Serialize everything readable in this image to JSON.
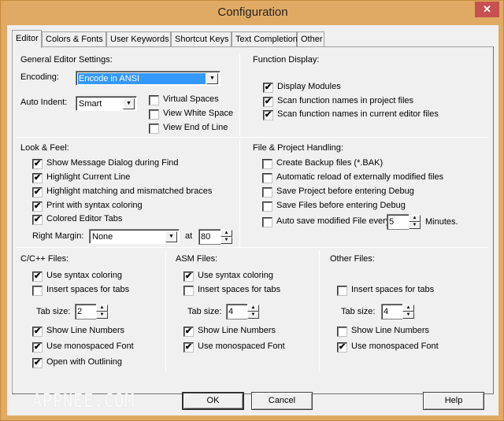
{
  "window": {
    "title": "Configuration",
    "close_icon": "close-icon"
  },
  "tabs": [
    {
      "label": "Editor",
      "active": true
    },
    {
      "label": "Colors & Fonts",
      "active": false
    },
    {
      "label": "User Keywords",
      "active": false
    },
    {
      "label": "Shortcut Keys",
      "active": false
    },
    {
      "label": "Text Completion",
      "active": false
    },
    {
      "label": "Other",
      "active": false
    }
  ],
  "general": {
    "heading": "General Editor Settings:",
    "encoding_label": "Encoding:",
    "encoding_value": "Encode in ANSI",
    "auto_indent_label": "Auto Indent:",
    "auto_indent_value": "Smart",
    "checkboxes": [
      {
        "label": "Virtual Spaces",
        "checked": false
      },
      {
        "label": "View White Space",
        "checked": false
      },
      {
        "label": "View End of Line",
        "checked": false
      }
    ]
  },
  "function_display": {
    "heading": "Function Display:",
    "checkboxes": [
      {
        "label": "Display Modules",
        "checked": true
      },
      {
        "label": "Scan function names in project files",
        "checked": true
      },
      {
        "label": "Scan function names in current editor files",
        "checked": true
      }
    ]
  },
  "look_feel": {
    "heading": "Look & Feel:",
    "checkboxes": [
      {
        "label": "Show Message Dialog during Find",
        "checked": true
      },
      {
        "label": "Highlight Current Line",
        "checked": true
      },
      {
        "label": "Highlight matching and mismatched braces",
        "checked": true
      },
      {
        "label": "Print with syntax coloring",
        "checked": true
      },
      {
        "label": "Colored Editor Tabs",
        "checked": true
      }
    ],
    "right_margin_label": "Right Margin:",
    "right_margin_value": "None",
    "at_label": "at",
    "at_value": "80"
  },
  "file_project": {
    "heading": "File & Project Handling:",
    "checkboxes": [
      {
        "label": "Create Backup files (*.BAK)",
        "checked": false
      },
      {
        "label": "Automatic reload of externally modified files",
        "checked": false
      },
      {
        "label": "Save Project before entering Debug",
        "checked": false
      },
      {
        "label": "Save Files before entering Debug",
        "checked": false
      },
      {
        "label": "Auto save modified File every",
        "checked": false
      }
    ],
    "autosave_value": "5",
    "minutes_label": "Minutes."
  },
  "cpp_files": {
    "heading": "C/C++ Files:",
    "use_syntax": {
      "label": "Use syntax coloring",
      "checked": true
    },
    "insert_spaces": {
      "label": "Insert spaces for tabs",
      "checked": false
    },
    "tab_size_label": "Tab size:",
    "tab_size_value": "2",
    "show_line_numbers": {
      "label": "Show Line Numbers",
      "checked": true
    },
    "monospaced": {
      "label": "Use monospaced Font",
      "checked": true
    },
    "outlining": {
      "label": "Open with Outlining",
      "checked": true
    }
  },
  "asm_files": {
    "heading": "ASM Files:",
    "use_syntax": {
      "label": "Use syntax coloring",
      "checked": true
    },
    "insert_spaces": {
      "label": "Insert spaces for tabs",
      "checked": false
    },
    "tab_size_label": "Tab size:",
    "tab_size_value": "4",
    "show_line_numbers": {
      "label": "Show Line Numbers",
      "checked": true
    },
    "monospaced": {
      "label": "Use monospaced Font",
      "checked": true
    }
  },
  "other_files": {
    "heading": "Other Files:",
    "insert_spaces": {
      "label": "Insert spaces for tabs",
      "checked": false
    },
    "tab_size_label": "Tab size:",
    "tab_size_value": "4",
    "show_line_numbers": {
      "label": "Show Line Numbers",
      "checked": false
    },
    "monospaced": {
      "label": "Use monospaced Font",
      "checked": true
    }
  },
  "buttons": {
    "ok": "OK",
    "cancel": "Cancel",
    "help": "Help"
  },
  "watermark": "APPNEE.COM",
  "glyphs": {
    "check": "✔",
    "close": "✕",
    "down_arrow": "▼",
    "spin_up": "▲",
    "spin_down": "▼"
  }
}
